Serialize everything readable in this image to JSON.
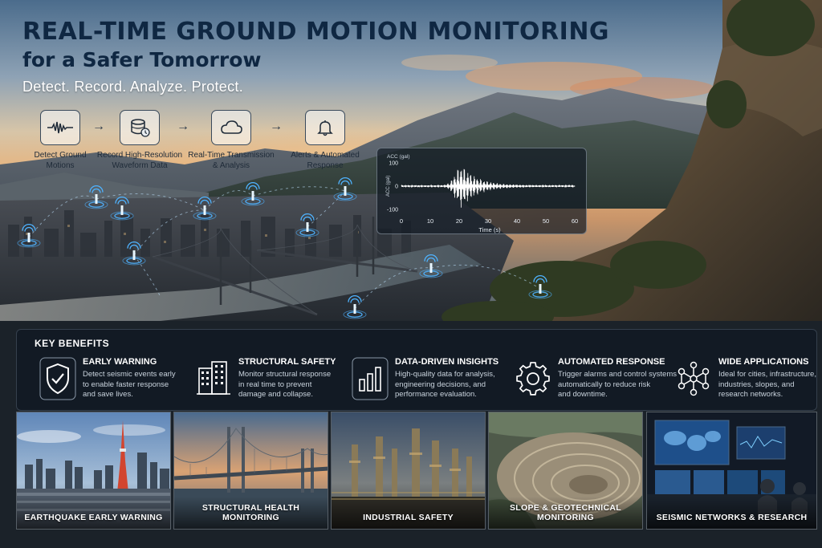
{
  "title": {
    "main": "REAL-TIME GROUND MOTION MONITORING",
    "sub": "for a Safer Tomorrow",
    "tagline": "Detect. Record. Analyze. Protect."
  },
  "steps": [
    {
      "label": "Detect Ground\nMotions",
      "icon": "waveform-icon"
    },
    {
      "label": "Record High-Resolution\nWaveform Data",
      "icon": "database-icon"
    },
    {
      "label": "Real-Time Transmission\n& Analysis",
      "icon": "cloud-icon"
    },
    {
      "label": "Alerts & Automated\nResponse",
      "icon": "bell-icon"
    }
  ],
  "chart_data": {
    "type": "line",
    "ylabel": "ACC (gal)",
    "xlabel": "Time (s)",
    "xlim": [
      0,
      60
    ],
    "ylim": [
      -100,
      100
    ],
    "x_ticks": [
      0,
      10,
      20,
      30,
      40,
      50,
      60
    ],
    "y_ticks": [
      100,
      0,
      -100
    ],
    "peak_time": 21,
    "peak_amplitude": 90
  },
  "benefits": {
    "title": "KEY BENEFITS",
    "items": [
      {
        "head": "EARLY WARNING",
        "desc": [
          "Detect seismic events early",
          "to enable faster response",
          "and save lives."
        ],
        "icon": "shield-check-icon"
      },
      {
        "head": "STRUCTURAL SAFETY",
        "desc": [
          "Monitor structural response",
          "in real time to prevent",
          "damage and collapse."
        ],
        "icon": "building-icon"
      },
      {
        "head": "DATA-DRIVEN INSIGHTS",
        "desc": [
          "High-quality data for analysis,",
          "engineering decisions, and",
          "performance evaluation."
        ],
        "icon": "bar-chart-icon"
      },
      {
        "head": "AUTOMATED RESPONSE",
        "desc": [
          "Trigger alarms and control systems",
          "automatically to reduce risk",
          "and downtime."
        ],
        "icon": "gear-icon"
      },
      {
        "head": "WIDE APPLICATIONS",
        "desc": [
          "Ideal for cities, infrastructure,",
          "industries, slopes, and",
          "research networks."
        ],
        "icon": "network-icon"
      }
    ]
  },
  "applications": [
    {
      "label": "EARTHQUAKE EARLY WARNING"
    },
    {
      "label": "STRUCTURAL HEALTH MONITORING"
    },
    {
      "label": "INDUSTRIAL SAFETY"
    },
    {
      "label": "SLOPE & GEOTECHNICAL MONITORING"
    },
    {
      "label": "SEISMIC NETWORKS & RESEARCH"
    }
  ],
  "colors": {
    "title": "#0f2742",
    "sensor": "#4fb3ff",
    "panel": "#121a24",
    "wave": "#ffffff"
  }
}
